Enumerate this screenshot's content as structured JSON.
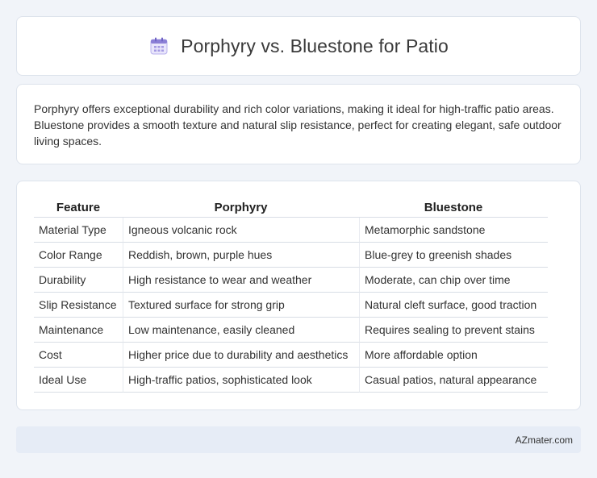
{
  "header": {
    "title": "Porphyry vs. Bluestone for Patio",
    "icon": "calendar-icon"
  },
  "description": "Porphyry offers exceptional durability and rich color variations, making it ideal for high-traffic patio areas. Bluestone provides a smooth texture and natural slip resistance, perfect for creating elegant, safe outdoor living spaces.",
  "table": {
    "headers": [
      "Feature",
      "Porphyry",
      "Bluestone"
    ],
    "rows": [
      [
        "Material Type",
        "Igneous volcanic rock",
        "Metamorphic sandstone"
      ],
      [
        "Color Range",
        "Reddish, brown, purple hues",
        "Blue-grey to greenish shades"
      ],
      [
        "Durability",
        "High resistance to wear and weather",
        "Moderate, can chip over time"
      ],
      [
        "Slip Resistance",
        "Textured surface for strong grip",
        "Natural cleft surface, good traction"
      ],
      [
        "Maintenance",
        "Low maintenance, easily cleaned",
        "Requires sealing to prevent stains"
      ],
      [
        "Cost",
        "Higher price due to durability and aesthetics",
        "More affordable option"
      ],
      [
        "Ideal Use",
        "High-traffic patios, sophisticated look",
        "Casual patios, natural appearance"
      ]
    ]
  },
  "footer": {
    "text": "AZmater.com"
  },
  "colors": {
    "background": "#f1f4f9",
    "footer_bg": "#e6ecf6",
    "icon_accent": "#8b7fd6"
  }
}
